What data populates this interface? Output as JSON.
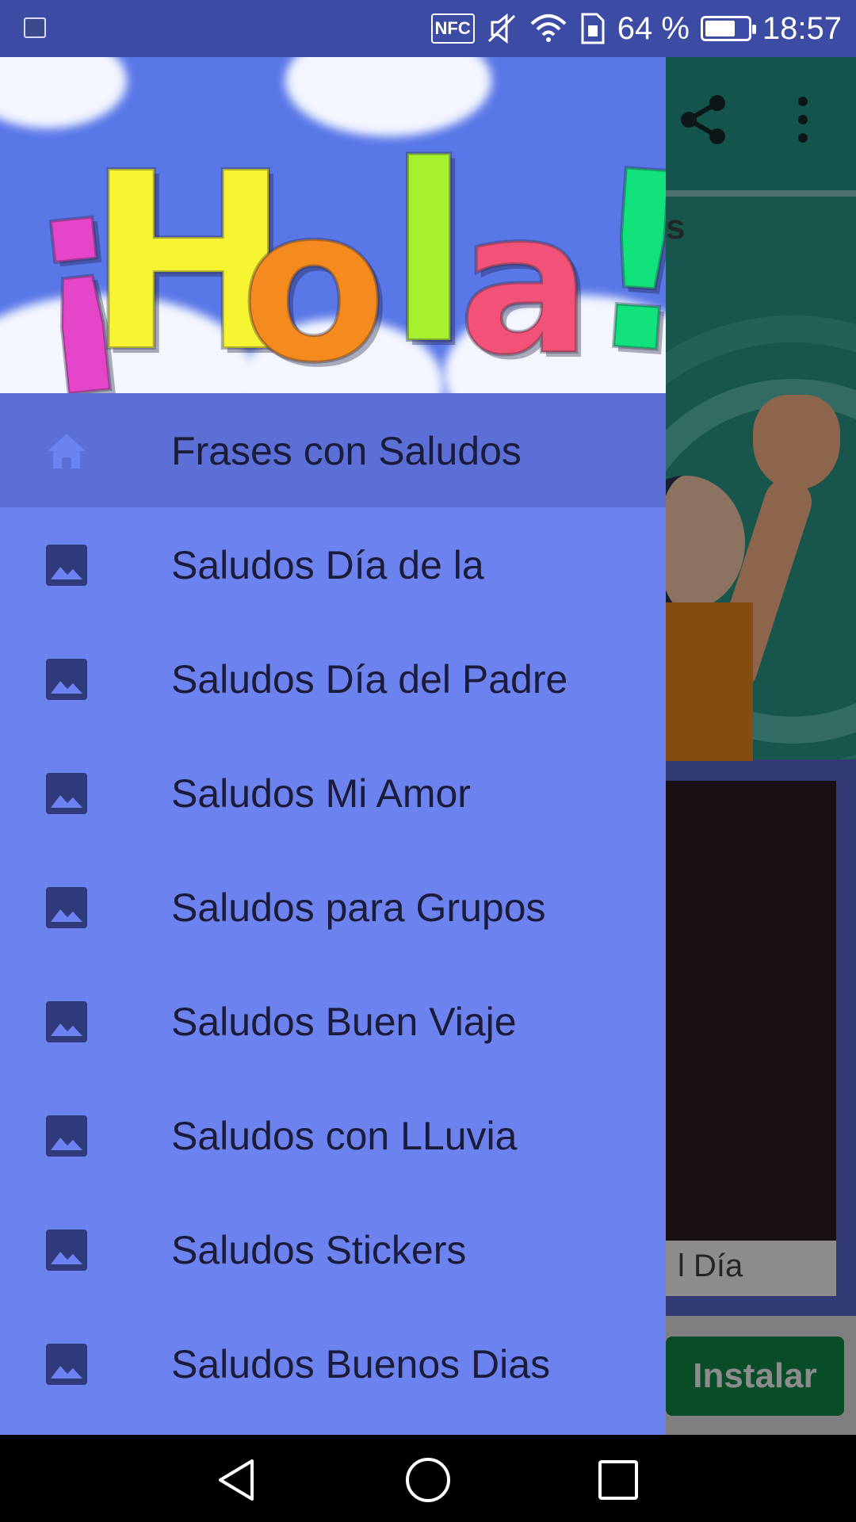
{
  "status_bar": {
    "battery_percent": "64 %",
    "battery_level": 0.64,
    "nfc_label": "NFC",
    "time": "18:57"
  },
  "background_app": {
    "video_caption": "l Día",
    "install_label": "Instalar",
    "colors": {
      "toolbar": "#239a8a",
      "install": "#118a4a"
    }
  },
  "drawer": {
    "header_logo_text": "¡Hola!",
    "items": [
      {
        "label": "Frases con Saludos",
        "icon": "home-icon",
        "active": true
      },
      {
        "label": "Saludos Día de la",
        "icon": "image-icon"
      },
      {
        "label": "Saludos Día del Padre",
        "icon": "image-icon"
      },
      {
        "label": "Saludos Mi Amor",
        "icon": "image-icon"
      },
      {
        "label": "Saludos para Grupos",
        "icon": "image-icon"
      },
      {
        "label": "Saludos Buen Viaje",
        "icon": "image-icon"
      },
      {
        "label": "Saludos con LLuvia",
        "icon": "image-icon"
      },
      {
        "label": "Saludos Stickers",
        "icon": "image-icon"
      },
      {
        "label": "Saludos Buenos Dias",
        "icon": "image-icon"
      }
    ],
    "colors": {
      "background": "#6c82ef",
      "active": "#5b6fd6",
      "icon": "#2f3a7a"
    }
  },
  "nav_bar": {
    "buttons": [
      "back-icon",
      "home-circle-icon",
      "recents-icon"
    ]
  }
}
